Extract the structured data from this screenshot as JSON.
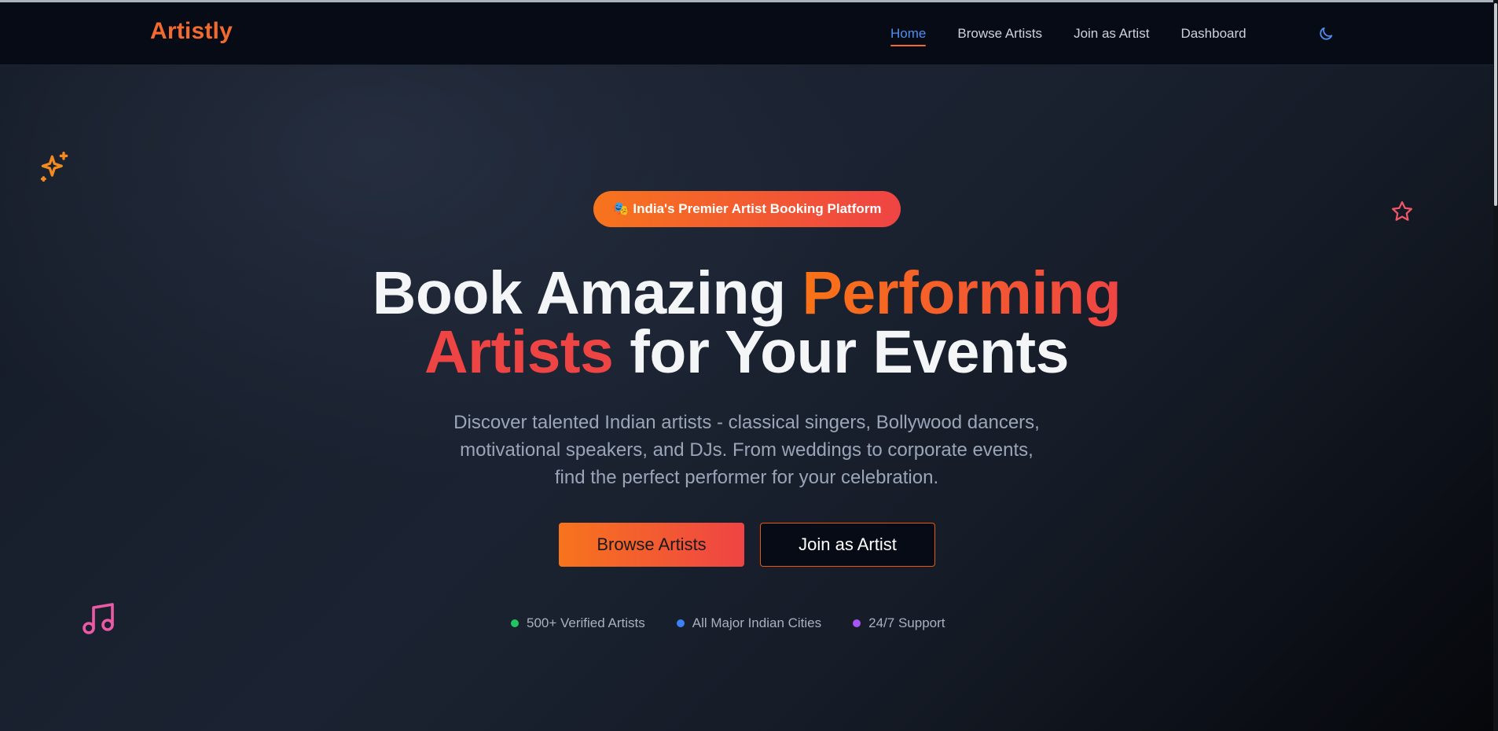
{
  "brand": {
    "name": "Artistly",
    "color": "#f26a2e"
  },
  "nav": {
    "links": [
      {
        "label": "Home",
        "active": true
      },
      {
        "label": "Browse Artists",
        "active": false
      },
      {
        "label": "Join as Artist",
        "active": false
      },
      {
        "label": "Dashboard",
        "active": false
      }
    ],
    "theme_toggle_icon": "moon-icon"
  },
  "decorations": {
    "icons": [
      "sparkles-icon",
      "star-icon",
      "music-note-icon"
    ]
  },
  "hero": {
    "badge": "🎭 India's Premier Artist Booking Platform",
    "title_part1": "Book Amazing ",
    "title_highlight1": "Performing",
    "title_highlight2": "Artists",
    "title_part2": " for Your Events",
    "subtitle_line1": "Discover talented Indian artists - classical singers, Bollywood dancers,",
    "subtitle_line2": "motivational speakers, and DJs. From weddings to corporate events,",
    "subtitle_line3": "find the perfect performer for your celebration.",
    "primary_button": "Browse Artists",
    "secondary_button": "Join as Artist"
  },
  "features": [
    {
      "label": "500+ Verified Artists",
      "dot_color": "#22c55e"
    },
    {
      "label": "All Major Indian Cities",
      "dot_color": "#3b82f6"
    },
    {
      "label": "24/7 Support",
      "dot_color": "#a855f7"
    }
  ],
  "colors": {
    "accent_orange": "#f97316",
    "accent_red": "#ef4444",
    "link_active": "#4f8ef0",
    "navbar_bg": "#060b16"
  }
}
